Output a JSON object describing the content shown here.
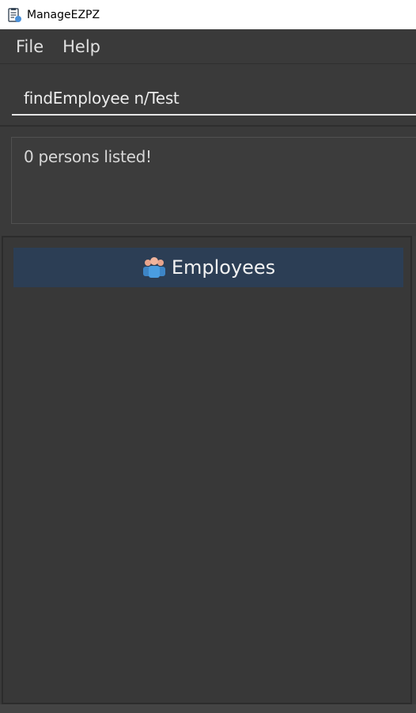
{
  "window": {
    "title": "ManageEZPZ",
    "icon": "clipboard-icon"
  },
  "menu": {
    "items": [
      "File",
      "Help"
    ]
  },
  "command": {
    "value": "findEmployee n/Test"
  },
  "result": {
    "message": "0 persons listed!"
  },
  "list": {
    "header_label": "Employees",
    "header_icon": "people-icon",
    "header_color": "#2c3e55"
  }
}
